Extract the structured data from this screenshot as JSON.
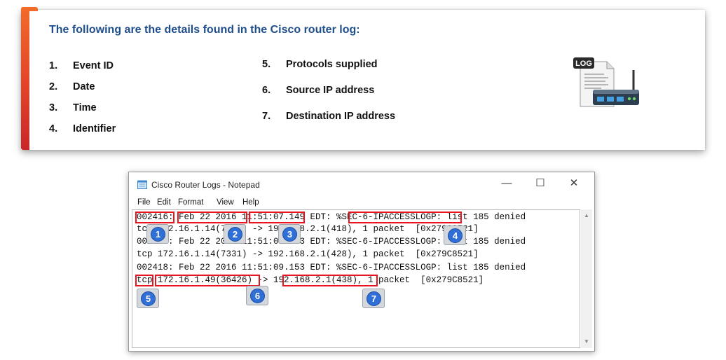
{
  "card": {
    "heading": "The following are the details found in the Cisco router log:",
    "left_items": [
      {
        "num": "1.",
        "label": "Event ID"
      },
      {
        "num": "2.",
        "label": "Date"
      },
      {
        "num": "3.",
        "label": "Time"
      },
      {
        "num": "4.",
        "label": "Identifier"
      }
    ],
    "right_items": [
      {
        "num": "5.",
        "label": "Protocols supplied"
      },
      {
        "num": "6.",
        "label": "Source IP address"
      },
      {
        "num": "7.",
        "label": "Destination IP address"
      }
    ],
    "icon_label": "LOG",
    "accent_color": "#e4472a",
    "heading_color": "#1f4e8c"
  },
  "notepad": {
    "title": "Cisco Router Logs - Notepad",
    "controls": {
      "minimize": "—",
      "maximize": "☐",
      "close": "✕"
    },
    "menu": {
      "file": "File",
      "edit": "Edit",
      "format": "Format",
      "view": "View",
      "help": "Help"
    },
    "lines": [
      "002416: Feb 22 2016 11:51:07.149 EDT: %SEC-6-IPACCESSLOGP: list 185 denied",
      "tcp 172.16.1.14(7395) -> 192.168.2.1(418), 1 packet  [0x279C8521]",
      "002417: Feb 22 2016 11:51:08.153 EDT: %SEC-6-IPACCESSLOGP: list 185 denied",
      "tcp 172.16.1.14(7331) -> 192.168.2.1(428), 1 packet  [0x279C8521]",
      "002418: Feb 22 2016 11:51:09.153 EDT: %SEC-6-IPACCESSLOGP: list 185 denied",
      "tcp 172.16.1.49(36426) -> 192.168.2.1(438), 1 packet  [0x279C8521]"
    ],
    "badges": [
      "1",
      "2",
      "3",
      "4",
      "5",
      "6",
      "7"
    ],
    "highlight_color": "#e8141e",
    "badge_color": "#2f6fd6"
  }
}
